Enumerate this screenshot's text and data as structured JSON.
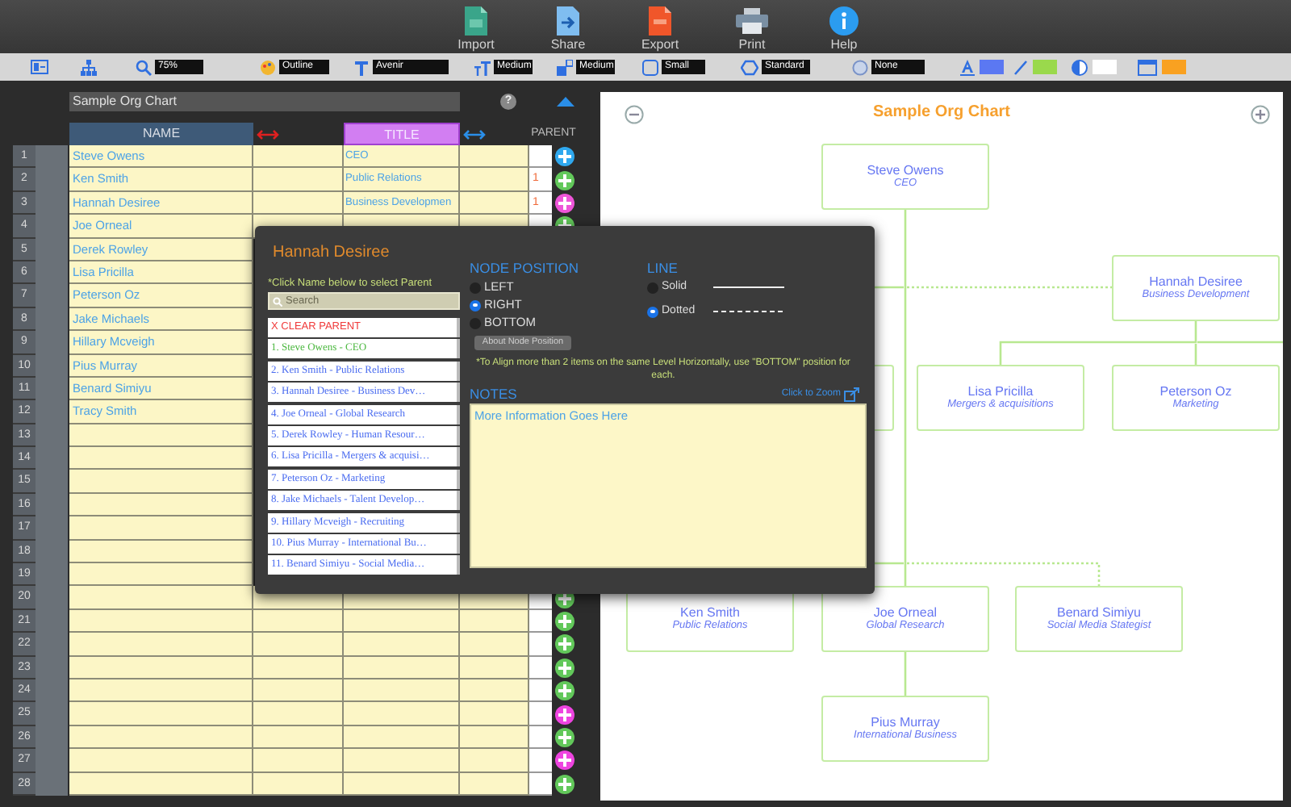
{
  "toolbar": {
    "buttons": [
      {
        "label": "Import",
        "kind": "csv"
      },
      {
        "label": "Share",
        "kind": "share"
      },
      {
        "label": "Export",
        "kind": "pdf"
      },
      {
        "label": "Print",
        "kind": "print"
      },
      {
        "label": "Help",
        "kind": "help"
      }
    ]
  },
  "format_bar": {
    "selects": [
      {
        "value": "75%"
      },
      {
        "value": "Outline"
      },
      {
        "value": "Avenir"
      },
      {
        "value": "Medium"
      },
      {
        "value": "Medium"
      },
      {
        "value": "Small"
      },
      {
        "value": "Standard"
      },
      {
        "value": "None"
      }
    ],
    "swatches": [
      {
        "color": "#5b78f2"
      },
      {
        "color": "#9ad94c"
      },
      {
        "color": "#ffffff"
      },
      {
        "color": "#f9a121"
      }
    ]
  },
  "sheet": {
    "title": "Sample Org Chart",
    "help": "?",
    "columns": [
      "NAME",
      "TITLE",
      "PARENT"
    ],
    "rows": [
      {
        "number": "1",
        "name": "Steve Owens",
        "title": "CEO",
        "color": "#2fa8ee"
      },
      {
        "number": "2",
        "name": "Ken Smith",
        "title": "Public Relations",
        "parent": "1",
        "color": "#62c85a"
      },
      {
        "number": "3",
        "name": "Hannah Desiree",
        "title": "Business Developmen",
        "parent": "1",
        "color": "#ee55d8"
      },
      {
        "number": "4",
        "name": "Joe Orneal",
        "color": "#62c85a"
      },
      {
        "number": "5",
        "name": "Derek Rowley"
      },
      {
        "number": "6",
        "name": "Lisa Pricilla"
      },
      {
        "number": "7",
        "name": "Peterson Oz"
      },
      {
        "number": "8",
        "name": "Jake Michaels"
      },
      {
        "number": "9",
        "name": "Hillary Mcveigh"
      },
      {
        "number": "10",
        "name": "Pius Murray"
      },
      {
        "number": "11",
        "name": "Benard Simiyu"
      },
      {
        "number": "12",
        "name": "Tracy Smith"
      },
      {
        "number": "13"
      },
      {
        "number": "14"
      },
      {
        "number": "15"
      },
      {
        "number": "16"
      },
      {
        "number": "17"
      },
      {
        "number": "18"
      },
      {
        "number": "19"
      },
      {
        "number": "20",
        "color": "#62c85a"
      },
      {
        "number": "21",
        "color": "#62c85a"
      },
      {
        "number": "22",
        "color": "#62c85a"
      },
      {
        "number": "23",
        "color": "#62c85a"
      },
      {
        "number": "24",
        "color": "#62c85a"
      },
      {
        "number": "25",
        "color": "#ee44e0"
      },
      {
        "number": "26",
        "color": "#62c85a"
      },
      {
        "number": "27",
        "color": "#ee44e0"
      },
      {
        "number": "28",
        "color": "#62c85a"
      }
    ]
  },
  "dialog": {
    "title": "Hannah Desiree",
    "hint": "*Click Name below to select Parent",
    "search": {
      "placeholder": "Search"
    },
    "parents": [
      {
        "label": "X CLEAR PARENT",
        "kind": "clear",
        "selected": false
      },
      {
        "label": "1. Steve Owens - CEO",
        "kind": "person",
        "selected": true
      },
      {
        "label": "2. Ken Smith - Public Relations",
        "kind": "person",
        "selected": false
      },
      {
        "label": "3. Hannah Desiree - Business Dev…",
        "kind": "person",
        "selected": false
      },
      {
        "label": "4. Joe Orneal - Global Research",
        "kind": "person",
        "selected": false
      },
      {
        "label": "5. Derek Rowley - Human Resour…",
        "kind": "person",
        "selected": false
      },
      {
        "label": "6. Lisa Pricilla - Mergers & acquisi…",
        "kind": "person",
        "selected": false
      },
      {
        "label": "7. Peterson Oz - Marketing",
        "kind": "person",
        "selected": false
      },
      {
        "label": "8. Jake Michaels - Talent Develop…",
        "kind": "person",
        "selected": false
      },
      {
        "label": "9. Hillary Mcveigh - Recruiting",
        "kind": "person",
        "selected": false
      },
      {
        "label": "10. Pius Murray - International Bu…",
        "kind": "person",
        "selected": false
      },
      {
        "label": "11. Benard Simiyu - Social Media…",
        "kind": "person",
        "selected": false
      }
    ],
    "node_position": {
      "heading": "NODE POSITION",
      "options": [
        {
          "label": "LEFT",
          "selected": false
        },
        {
          "label": "RIGHT",
          "selected": true
        },
        {
          "label": "BOTTOM",
          "selected": false
        }
      ],
      "about_button": "About Node Position"
    },
    "line": {
      "heading": "LINE",
      "options": [
        {
          "label": "Solid",
          "kind": "solid",
          "selected": false
        },
        {
          "label": "Dotted",
          "kind": "dotted",
          "selected": true
        }
      ]
    },
    "note": "*To Align more than 2 items on the same Level Horizontally, use \"BOTTOM\" position for each.",
    "notes": {
      "heading": "NOTES",
      "zoom_link": "Click to Zoom",
      "value": "More Information Goes Here"
    }
  },
  "chart": {
    "title": "Sample Org Chart",
    "nodes": [
      {
        "name": "Steve Owens",
        "title": "CEO"
      },
      {
        "name": "Hannah Desiree",
        "title": "Business Development"
      },
      {
        "name": "Lisa Pricilla",
        "title": "Mergers & acquisitions"
      },
      {
        "name": "Peterson Oz",
        "title": "Marketing"
      },
      {
        "name": "Ken Smith",
        "title": "Public Relations"
      },
      {
        "name": "Joe Orneal",
        "title": "Global Research"
      },
      {
        "name": "Benard Simiyu",
        "title": "Social Media Stategist"
      },
      {
        "name": "Pius Murray",
        "title": "International Business"
      }
    ]
  }
}
